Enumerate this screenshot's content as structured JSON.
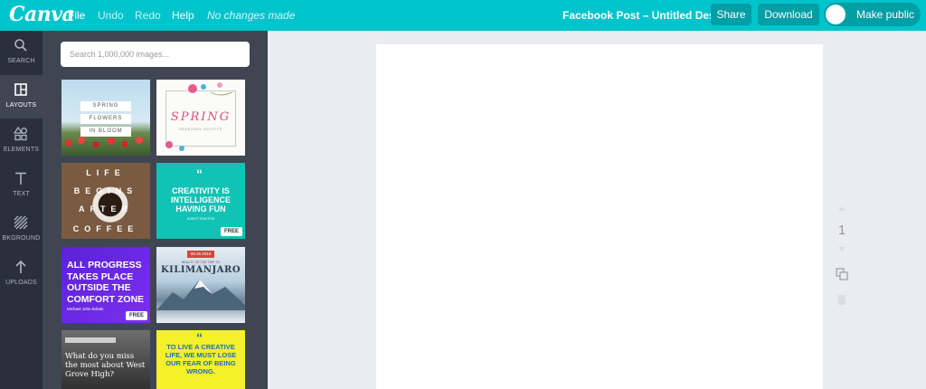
{
  "app": {
    "logo": "Canva"
  },
  "menu": {
    "file": "File",
    "undo": "Undo",
    "redo": "Redo",
    "help": "Help",
    "status": "No changes made"
  },
  "header": {
    "doc_title": "Facebook Post – Untitled Design",
    "share": "Share",
    "download": "Download",
    "make_public": "Make public"
  },
  "rail": [
    {
      "label": "SEARCH",
      "icon": "search-icon"
    },
    {
      "label": "LAYOUTS",
      "icon": "layouts-icon",
      "active": true
    },
    {
      "label": "ELEMENTS",
      "icon": "elements-icon"
    },
    {
      "label": "TEXT",
      "icon": "text-icon"
    },
    {
      "label": "BKGROUND",
      "icon": "background-icon"
    },
    {
      "label": "UPLOADS",
      "icon": "upload-icon"
    }
  ],
  "search": {
    "placeholder": "Search 1,000,000 images..."
  },
  "layouts": {
    "t1": {
      "l1": "SPRING",
      "l2": "FLOWERS",
      "l3": "IN BLOOM"
    },
    "t2": {
      "title": "SPRING",
      "sub": "SEASONAL OUTFITS"
    },
    "t3": {
      "l1": "LIFE",
      "l2": "BEGINS",
      "l3": "AFTER",
      "l4": "COFFEE"
    },
    "t4": {
      "text": "CREATIVITY IS INTELLIGENCE HAVING FUN",
      "sub": "ALBERT EINSTEIN",
      "badge": "FREE"
    },
    "t5": {
      "text": "ALL PROGRESS TAKES PLACE OUTSIDE THE COMFORT ZONE",
      "sub": "Michael John Bobak",
      "badge": "FREE"
    },
    "t6": {
      "date": "09.26.2016",
      "sub": "BEAUTY OF THE TRIP TO",
      "title": "KILIMANJARO"
    },
    "t7": {
      "top": "",
      "text": "What do you miss the most about West Grove High?"
    },
    "t8": {
      "text": "TO LIVE A CREATIVE LIFE, WE MUST LOSE OUR FEAR OF BEING WRONG."
    }
  },
  "canvas": {
    "page_number": "1"
  }
}
